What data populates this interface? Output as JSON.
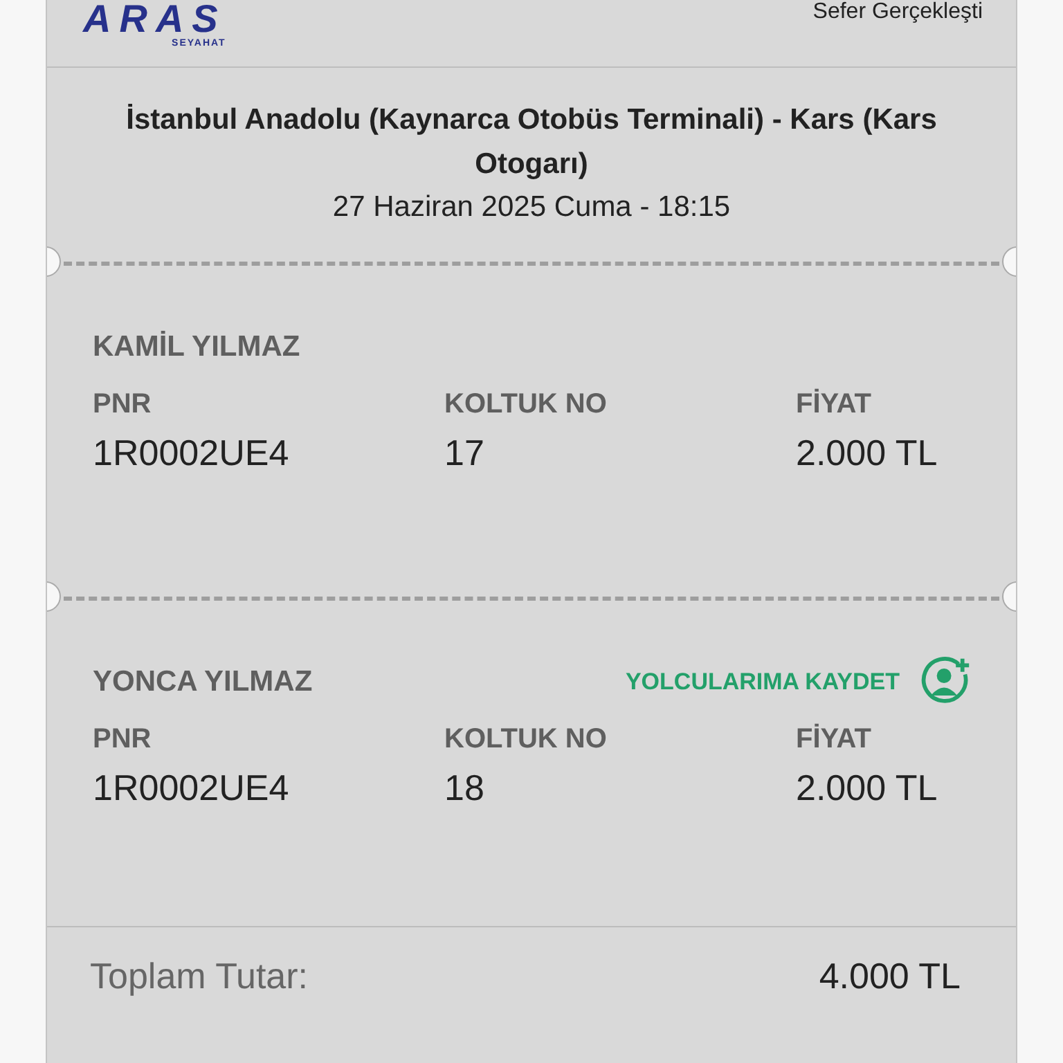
{
  "header": {
    "logo": "ARAS",
    "logo_sub": "SEYAHAT",
    "status": "Sefer Gerçekleşti"
  },
  "route": {
    "title": "İstanbul Anadolu (Kaynarca Otobüs Terminali) - Kars (Kars Otogarı)",
    "date": "27 Haziran 2025 Cuma - 18:15"
  },
  "passengers": [
    {
      "name": "KAMİL YILMAZ",
      "pnr_label": "PNR",
      "pnr": "1R0002UE4",
      "seat_label": "KOLTUK NO",
      "seat": "17",
      "price_label": "FİYAT",
      "price": "2.000 TL"
    },
    {
      "name": "YONCA YILMAZ",
      "save_label": "YOLCULARIMA KAYDET",
      "pnr_label": "PNR",
      "pnr": "1R0002UE4",
      "seat_label": "KOLTUK NO",
      "seat": "18",
      "price_label": "FİYAT",
      "price": "2.000 TL"
    }
  ],
  "total": {
    "label": "Toplam Tutar:",
    "value": "4.000 TL"
  }
}
